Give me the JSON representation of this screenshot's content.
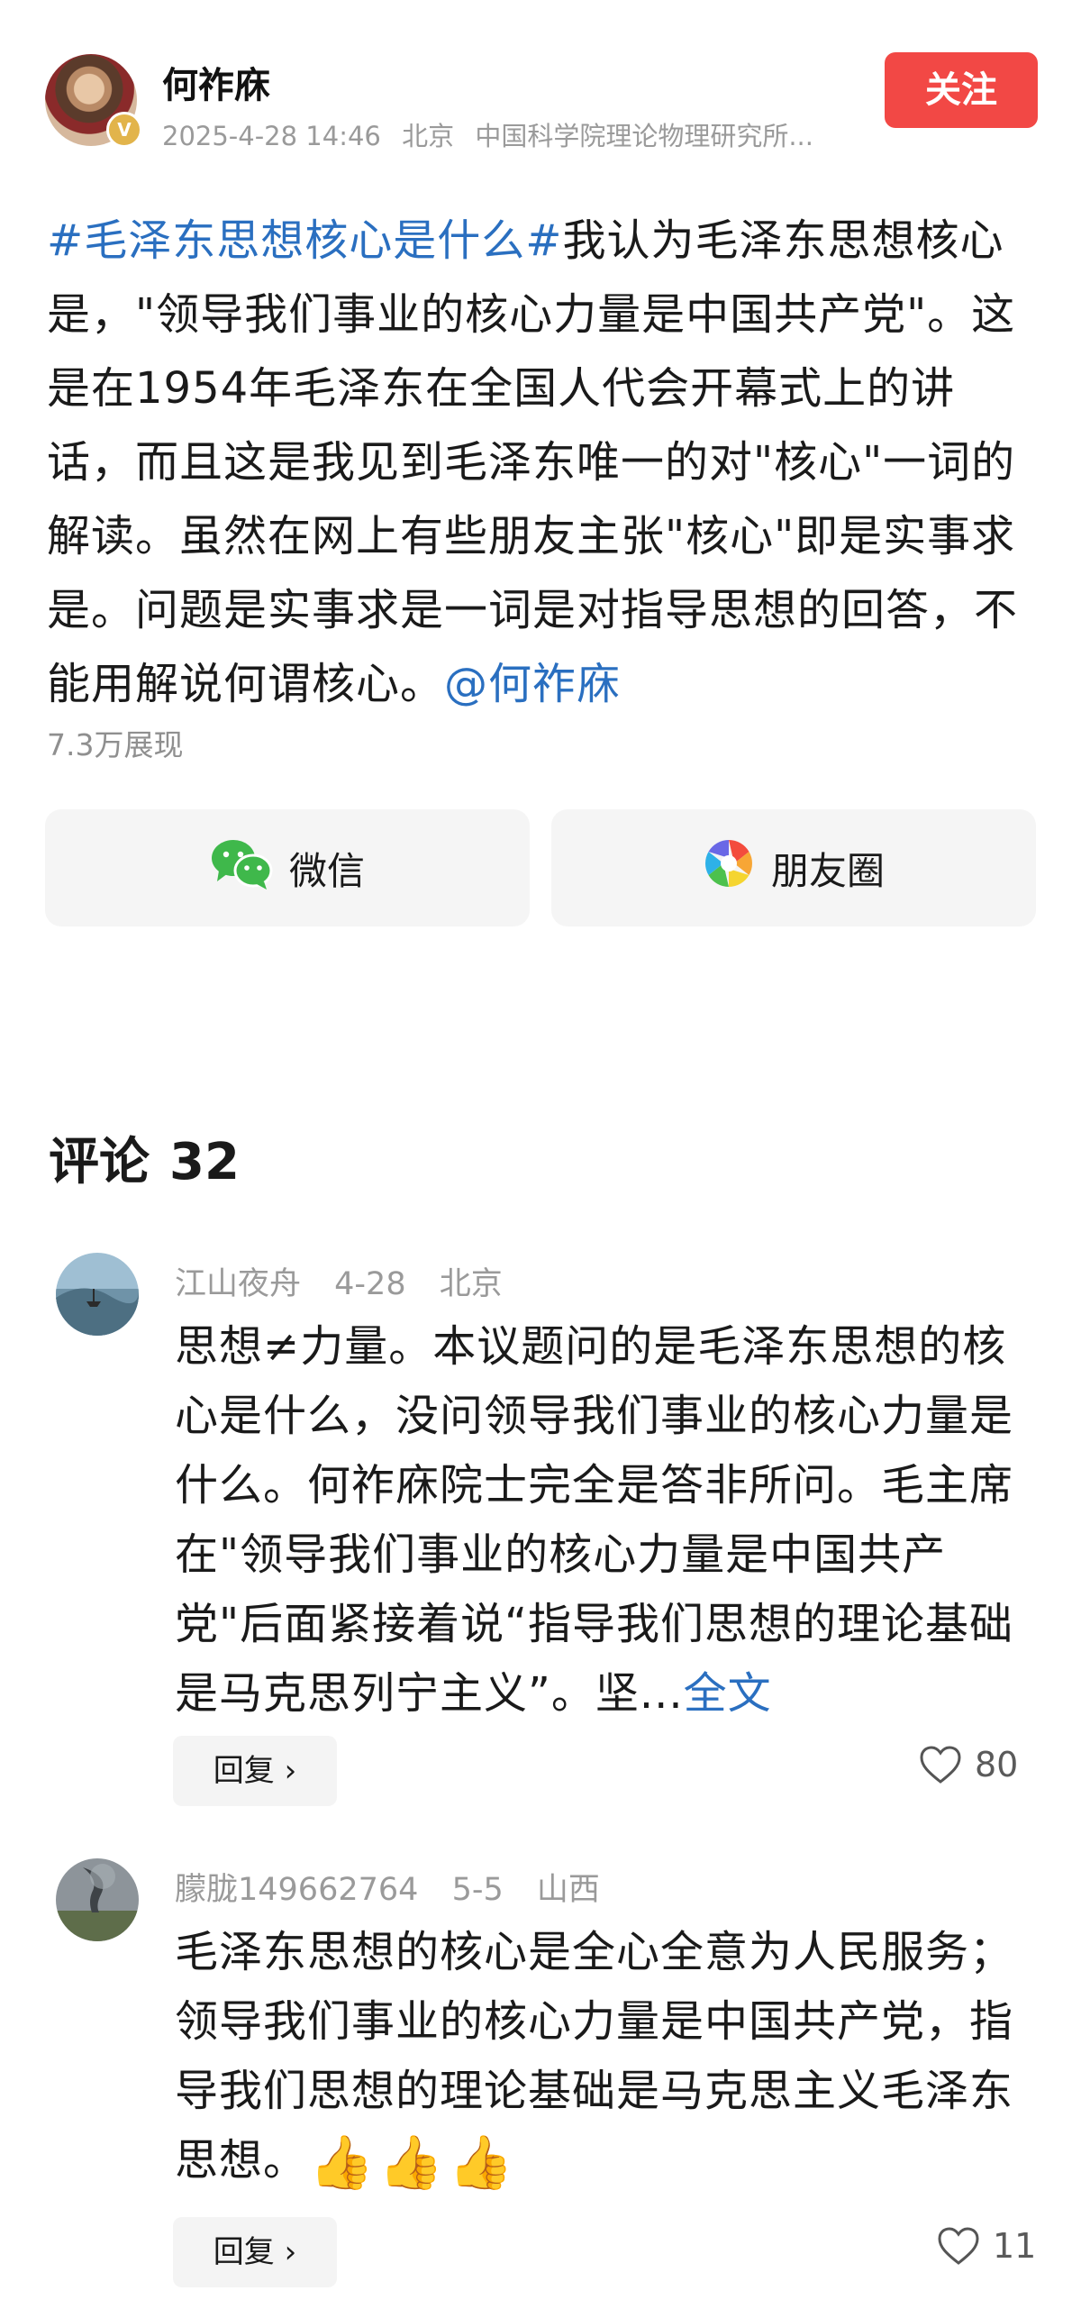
{
  "author": {
    "name": "何祚庥",
    "verified_badge": "V",
    "date": "2025-4-28 14:46",
    "location": "北京",
    "org": "中国科学院理论物理研究所..."
  },
  "follow_label": "关注",
  "post": {
    "topic": "#毛泽东思想核心是什么#",
    "body": "我认为毛泽东思想核心是，\"领导我们事业的核心力量是中国共产党\"。这是在1954年毛泽东在全国人代会开幕式上的讲话，而且这是我见到毛泽东唯一的对\"核心\"一词的解读。虽然在网上有些朋友主张\"核心\"即是实事求是。问题是实事求是一词是对指导思想的回答，不能用解说何谓核心。",
    "mention": "@何祚庥",
    "views": "7.3万展现"
  },
  "share": {
    "wechat_label": "微信",
    "moments_label": "朋友圈"
  },
  "comments_header": {
    "label": "评论",
    "count": "32"
  },
  "comments": [
    {
      "user": "江山夜舟",
      "date": "4-28",
      "location": "北京",
      "text": "思想≠力量。本议题问的是毛泽东思想的核心是什么，没问领导我们事业的核心力量是什么。何祚庥院士完全是答非所问。毛主席在\"领导我们事业的核心力量是中国共产党\"后面紧接着说“指导我们思想的理论基础是马克思列宁主义”。坚...",
      "more_label": "全文",
      "reply_label": "回复 ›",
      "likes": "80"
    },
    {
      "user": "朦胧149662764",
      "date": "5-5",
      "location": "山西",
      "text": "毛泽东思想的核心是全心全意为人民服务；领导我们事业的核心力量是中国共产党，指导我们思想的理论基础是马克思主义毛泽东思想。",
      "emoji": "👍",
      "reply_label": "回复 ›",
      "likes": "11"
    }
  ],
  "colors": {
    "accent_red": "#f24845",
    "link_blue": "#2a6fc0",
    "meta_gray": "#9a9a9a",
    "button_bg": "#f5f5f5"
  },
  "icons": [
    "wechat-icon",
    "moments-icon",
    "heart-icon",
    "verified-icon"
  ]
}
